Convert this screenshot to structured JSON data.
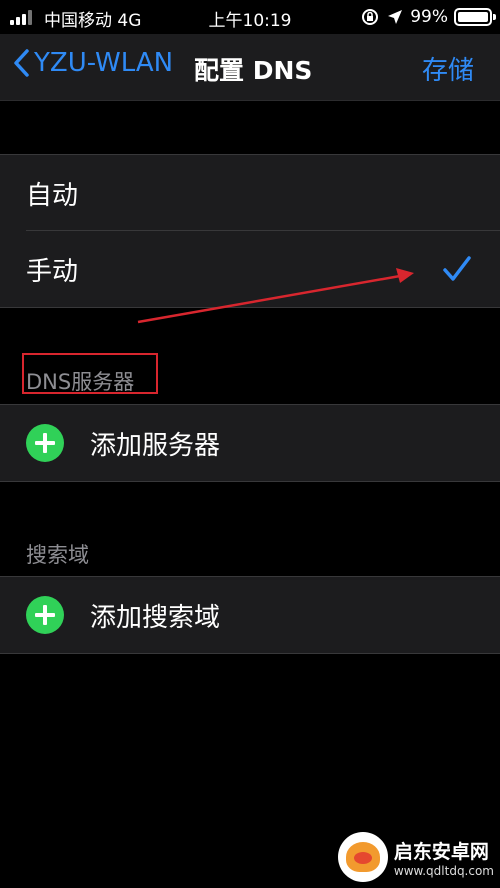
{
  "status_bar": {
    "carrier": "中国移动  4G",
    "time": "上午10:19",
    "battery_percent": "99%",
    "battery_level": 0.99,
    "icons": [
      "signal-icon",
      "lock-rotation-icon",
      "location-arrow-icon",
      "battery-icon"
    ]
  },
  "nav": {
    "back_label": "YZU-WLAN",
    "title": "配置 DNS",
    "save_label": "存储"
  },
  "mode_options": [
    {
      "label": "自动",
      "selected": false
    },
    {
      "label": "手动",
      "selected": true
    }
  ],
  "dns_section": {
    "header": "DNS服务器",
    "add_label": "添加服务器"
  },
  "search_section": {
    "header": "搜索域",
    "add_label": "添加搜索域"
  },
  "watermark": {
    "name": "启东安卓网",
    "url": "www.qdltdq.com"
  },
  "colors": {
    "accent": "#2f8af5",
    "add_green": "#30d158",
    "annotation_red": "#d8262e",
    "cell_bg": "#1c1c1e"
  }
}
